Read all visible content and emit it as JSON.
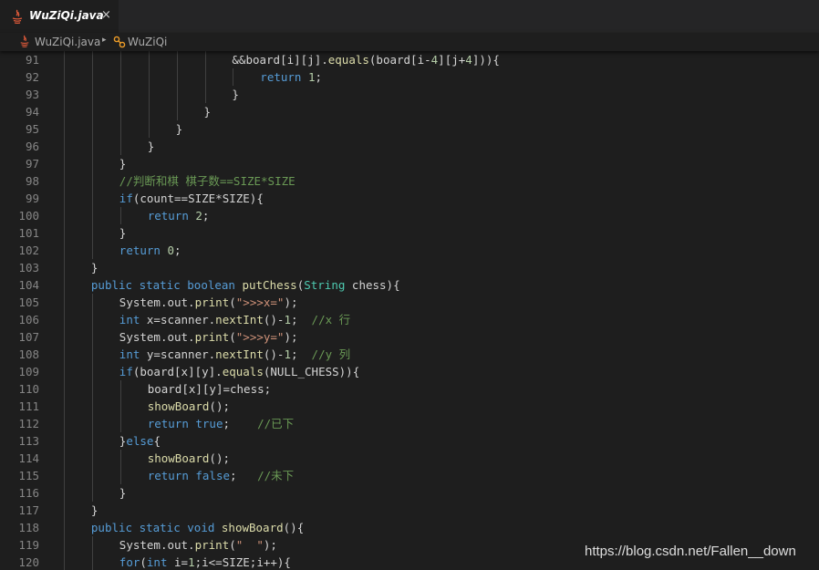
{
  "tab": {
    "label": "WuZiQi.java",
    "close": "×",
    "icon": "java-file-icon"
  },
  "breadcrumb": {
    "file": "WuZiQi.java",
    "separator": "▸",
    "class_name": "WuZiQi"
  },
  "colors": {
    "keyword": "#569cd6",
    "type": "#4ec9b0",
    "number": "#b5cea8",
    "string": "#ce9178",
    "comment": "#6a9955",
    "function": "#dcdcaa",
    "text": "#d4d4d4",
    "line_number": "#858585",
    "background": "#1e1e1e"
  },
  "lines": [
    {
      "n": "91",
      "indent": 6,
      "t": [
        [
          "&&board[i][j].",
          ""
        ],
        [
          "equals",
          "fn"
        ],
        [
          "(board[i-",
          ""
        ],
        [
          "4",
          "num"
        ],
        [
          "][j+",
          ""
        ],
        [
          "4",
          "num"
        ],
        [
          "])){",
          ""
        ]
      ]
    },
    {
      "n": "92",
      "indent": 7,
      "t": [
        [
          "return",
          "kw"
        ],
        [
          " ",
          ""
        ],
        [
          "1",
          "num"
        ],
        [
          ";",
          ""
        ]
      ]
    },
    {
      "n": "93",
      "indent": 6,
      "t": [
        [
          "}",
          ""
        ]
      ]
    },
    {
      "n": "94",
      "indent": 5,
      "t": [
        [
          "}",
          ""
        ]
      ]
    },
    {
      "n": "95",
      "indent": 4,
      "t": [
        [
          "}",
          ""
        ]
      ]
    },
    {
      "n": "96",
      "indent": 3,
      "t": [
        [
          "}",
          ""
        ]
      ]
    },
    {
      "n": "97",
      "indent": 2,
      "t": [
        [
          "}",
          ""
        ]
      ]
    },
    {
      "n": "98",
      "indent": 2,
      "t": [
        [
          "//判断和棋 棋子数==SIZE*SIZE",
          "cm"
        ]
      ]
    },
    {
      "n": "99",
      "indent": 2,
      "t": [
        [
          "if",
          "kw"
        ],
        [
          "(count==SIZE*SIZE){",
          ""
        ]
      ]
    },
    {
      "n": "100",
      "indent": 3,
      "t": [
        [
          "return",
          "kw"
        ],
        [
          " ",
          ""
        ],
        [
          "2",
          "num"
        ],
        [
          ";",
          ""
        ]
      ]
    },
    {
      "n": "101",
      "indent": 2,
      "t": [
        [
          "}",
          ""
        ]
      ]
    },
    {
      "n": "102",
      "indent": 2,
      "t": [
        [
          "return",
          "kw"
        ],
        [
          " ",
          ""
        ],
        [
          "0",
          "num"
        ],
        [
          ";",
          ""
        ]
      ]
    },
    {
      "n": "103",
      "indent": 1,
      "t": [
        [
          "}",
          ""
        ]
      ]
    },
    {
      "n": "104",
      "indent": 1,
      "t": [
        [
          "public",
          "kw"
        ],
        [
          " ",
          ""
        ],
        [
          "static",
          "kw"
        ],
        [
          " ",
          ""
        ],
        [
          "boolean",
          "kw"
        ],
        [
          " ",
          ""
        ],
        [
          "putChess",
          "fn"
        ],
        [
          "(",
          ""
        ],
        [
          "String",
          "ty"
        ],
        [
          " chess){",
          ""
        ]
      ]
    },
    {
      "n": "105",
      "indent": 2,
      "t": [
        [
          "System.out.",
          ""
        ],
        [
          "print",
          "fn"
        ],
        [
          "(",
          ""
        ],
        [
          "\">>>x=\"",
          "str"
        ],
        [
          ");",
          ""
        ]
      ]
    },
    {
      "n": "106",
      "indent": 2,
      "t": [
        [
          "int",
          "kw"
        ],
        [
          " x=scanner.",
          ""
        ],
        [
          "nextInt",
          "fn"
        ],
        [
          "()-",
          ""
        ],
        [
          "1",
          "num"
        ],
        [
          ";  ",
          ""
        ],
        [
          "//x 行",
          "cm"
        ]
      ]
    },
    {
      "n": "107",
      "indent": 2,
      "t": [
        [
          "System.out.",
          ""
        ],
        [
          "print",
          "fn"
        ],
        [
          "(",
          ""
        ],
        [
          "\">>>y=\"",
          "str"
        ],
        [
          ");",
          ""
        ]
      ]
    },
    {
      "n": "108",
      "indent": 2,
      "t": [
        [
          "int",
          "kw"
        ],
        [
          " y=scanner.",
          ""
        ],
        [
          "nextInt",
          "fn"
        ],
        [
          "()-",
          ""
        ],
        [
          "1",
          "num"
        ],
        [
          ";  ",
          ""
        ],
        [
          "//y 列",
          "cm"
        ]
      ]
    },
    {
      "n": "109",
      "indent": 2,
      "t": [
        [
          "if",
          "kw"
        ],
        [
          "(board[x][y].",
          ""
        ],
        [
          "equals",
          "fn"
        ],
        [
          "(NULL_CHESS)){",
          ""
        ]
      ]
    },
    {
      "n": "110",
      "indent": 3,
      "t": [
        [
          "board[x][y]=chess;",
          ""
        ]
      ]
    },
    {
      "n": "111",
      "indent": 3,
      "t": [
        [
          "showBoard",
          "fn"
        ],
        [
          "();",
          ""
        ]
      ]
    },
    {
      "n": "112",
      "indent": 3,
      "t": [
        [
          "return",
          "kw"
        ],
        [
          " ",
          ""
        ],
        [
          "true",
          "kw"
        ],
        [
          ";    ",
          ""
        ],
        [
          "//已下",
          "cm"
        ]
      ]
    },
    {
      "n": "113",
      "indent": 2,
      "t": [
        [
          "}",
          ""
        ],
        [
          "else",
          "kw"
        ],
        [
          "{",
          ""
        ]
      ]
    },
    {
      "n": "114",
      "indent": 3,
      "t": [
        [
          "showBoard",
          "fn"
        ],
        [
          "();",
          ""
        ]
      ]
    },
    {
      "n": "115",
      "indent": 3,
      "t": [
        [
          "return",
          "kw"
        ],
        [
          " ",
          ""
        ],
        [
          "false",
          "kw"
        ],
        [
          ";   ",
          ""
        ],
        [
          "//未下",
          "cm"
        ]
      ]
    },
    {
      "n": "116",
      "indent": 2,
      "t": [
        [
          "}",
          ""
        ]
      ]
    },
    {
      "n": "117",
      "indent": 1,
      "t": [
        [
          "}",
          ""
        ]
      ]
    },
    {
      "n": "118",
      "indent": 1,
      "t": [
        [
          "public",
          "kw"
        ],
        [
          " ",
          ""
        ],
        [
          "static",
          "kw"
        ],
        [
          " ",
          ""
        ],
        [
          "void",
          "kw"
        ],
        [
          " ",
          ""
        ],
        [
          "showBoard",
          "fn"
        ],
        [
          "(){",
          ""
        ]
      ]
    },
    {
      "n": "119",
      "indent": 2,
      "t": [
        [
          "System.out.",
          ""
        ],
        [
          "print",
          "fn"
        ],
        [
          "(",
          ""
        ],
        [
          "\"  \"",
          "str"
        ],
        [
          ");",
          ""
        ]
      ]
    },
    {
      "n": "120",
      "indent": 2,
      "t": [
        [
          "for",
          "kw"
        ],
        [
          "(",
          ""
        ],
        [
          "int",
          "kw"
        ],
        [
          " i=",
          ""
        ],
        [
          "1",
          "num"
        ],
        [
          ";i<=SIZE;i++){",
          ""
        ]
      ]
    }
  ],
  "watermark": "https://blog.csdn.net/Fallen__down"
}
